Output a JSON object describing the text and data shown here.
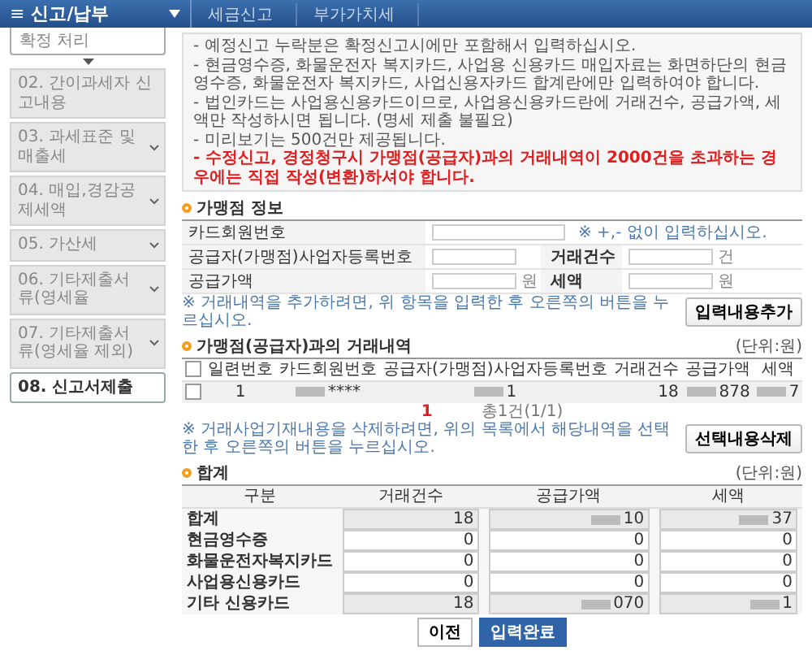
{
  "header": {
    "menu_icon": "≡",
    "title": "신고/납부",
    "breadcrumbs": [
      "세금신고",
      "부가가치세"
    ]
  },
  "sidebar": {
    "top_item": "확정 처리",
    "items": [
      {
        "label": "02. 간이과세자 신고내용",
        "has_children": false,
        "selected": false
      },
      {
        "label": "03. 과세표준 및 매출세",
        "has_children": true,
        "selected": false
      },
      {
        "label": "04. 매입,경감공제세액",
        "has_children": true,
        "selected": false
      },
      {
        "label": "05. 가산세",
        "has_children": true,
        "selected": false
      },
      {
        "label": "06. 기타제출서류(영세율",
        "has_children": true,
        "selected": false
      },
      {
        "label": "07. 기타제출서류(영세율 제외)",
        "has_children": true,
        "selected": false
      },
      {
        "label": "08. 신고서제출",
        "has_children": false,
        "selected": true
      }
    ]
  },
  "notice": [
    {
      "text": "- 예정신고 누락분은 확정신고시에만 포함해서 입력하십시오.",
      "warning": false
    },
    {
      "text": "- 현금영수증, 화물운전자 복지카드, 사업용 신용카드 매입자료는 화면하단의 현금영수증, 화물운전자 복지카드, 사업신용자카드 합계란에만 입력하여야 합니다.",
      "warning": false
    },
    {
      "text": "- 법인카드는 사업용신용카드이므로, 사업용신용카드란에 거래건수, 공급가액, 세액만 작성하시면 됩니다. (명세 제출 불필요)",
      "warning": false
    },
    {
      "text": "- 미리보기는 500건만 제공됩니다.",
      "warning": false
    },
    {
      "text": "- 수정신고, 경정청구시 가맹점(공급자)과의 거래내역이 2000건을 초과하는 경우에는 직접 작성(변환)하셔야 합니다.",
      "warning": true
    }
  ],
  "merchant_info": {
    "title": "가맹점 정보",
    "card_label": "카드회원번호",
    "card_hint": "※ +,- 없이 입력하십시오.",
    "biz_label": "공급자(가맹점)사업자등록번호",
    "count_label": "거래건수",
    "count_unit": "건",
    "supply_label": "공급가액",
    "supply_unit": "원",
    "tax_label": "세액",
    "tax_unit": "원",
    "note": "※ 거래내역을 추가하려면, 위 항목을 입력한 후 오른쪽의 버튼을 누르십시오.",
    "add_button": "입력내용추가"
  },
  "transactions": {
    "title": "가맹점(공급자)과의 거래내역",
    "unit": "(단위:원)",
    "all_checked": false,
    "columns": [
      "일련번호",
      "카드회원번호",
      "공급자(가맹점)사업자등록번호",
      "거래건수",
      "공급가액",
      "세액"
    ],
    "rows": [
      {
        "checked": false,
        "cells": [
          "1",
          "****",
          "1",
          "18",
          "878",
          "7"
        ]
      }
    ],
    "page": "1",
    "page_info": "총1건(1/1)",
    "note": "※ 거래사업기재내용을 삭제하려면, 위의 목록에서 해당내역을 선택한 후 오른쪽의 버튼을 누르십시오.",
    "delete_button": "선택내용삭제"
  },
  "summary": {
    "title": "합계",
    "unit": "(단위:원)",
    "columns": [
      "구분",
      "거래건수",
      "공급가액",
      "세액"
    ],
    "rows": [
      {
        "label": "합계",
        "readonly": true,
        "values": [
          "18",
          "10",
          "37"
        ]
      },
      {
        "label": "현금영수증",
        "readonly": false,
        "values": [
          "0",
          "0",
          "0"
        ]
      },
      {
        "label": "화물운전자복지카드",
        "readonly": false,
        "values": [
          "0",
          "0",
          "0"
        ]
      },
      {
        "label": "사업용신용카드",
        "readonly": false,
        "values": [
          "0",
          "0",
          "0"
        ]
      },
      {
        "label": "기타 신용카드",
        "readonly": true,
        "values": [
          "18",
          "070",
          "1"
        ]
      }
    ]
  },
  "buttons": [
    {
      "label": "이전",
      "primary": false
    },
    {
      "label": "입력완료",
      "primary": true
    }
  ]
}
